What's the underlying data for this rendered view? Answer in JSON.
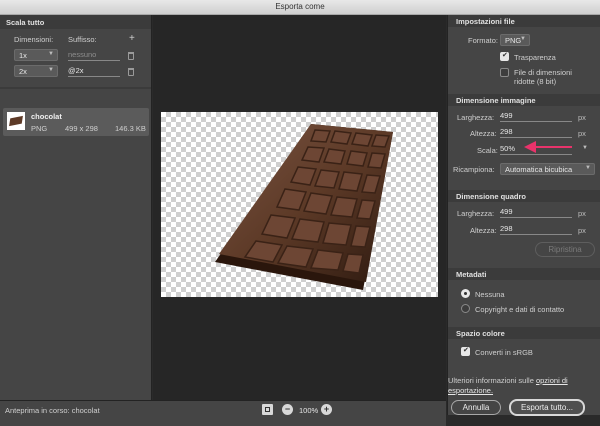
{
  "window": {
    "title": "Esporta come"
  },
  "left": {
    "section_title": "Scala tutto",
    "dimensions_header": "Dimensioni:",
    "suffix_header": "Suffisso:",
    "add_symbol": "+",
    "rows": [
      {
        "scale": "1x",
        "suffix": "",
        "suffix_placeholder": "nessuno"
      },
      {
        "scale": "2x",
        "suffix": "@2x",
        "suffix_placeholder": ""
      }
    ],
    "asset": {
      "name": "chocolat",
      "format": "PNG",
      "size": "499 x 298",
      "filesize": "146.3 KB"
    }
  },
  "preview": {
    "label": "Anteprima in corso:",
    "name": "chocolat",
    "zoom": "100%",
    "minus": "−",
    "plus": "+"
  },
  "right": {
    "file_settings": {
      "title": "Impostazioni file",
      "format_label": "Formato:",
      "format_value": "PNG",
      "transparency_label": "Trasparenza",
      "transparency_checked": true,
      "small_file_label_1": "File di dimensioni",
      "small_file_label_2": "ridotte (8 bit)",
      "small_file_checked": false
    },
    "image_size": {
      "title": "Dimensione immagine",
      "width_label": "Larghezza:",
      "width_value": "499",
      "height_label": "Altezza:",
      "height_value": "298",
      "scale_label": "Scala:",
      "scale_value": "50%",
      "resample_label": "Ricampiona:",
      "resample_value": "Automatica bicubica",
      "unit": "px"
    },
    "canvas_size": {
      "title": "Dimensione quadro",
      "width_label": "Larghezza:",
      "width_value": "499",
      "height_label": "Altezza:",
      "height_value": "298",
      "reset_label": "Ripristina",
      "unit": "px"
    },
    "metadata": {
      "title": "Metadati",
      "option_none": "Nessuna",
      "option_copyright": "Copyright e dati di contatto",
      "selected": "none"
    },
    "color_space": {
      "title": "Spazio colore",
      "convert_label": "Converti in sRGB",
      "convert_checked": true
    },
    "more_info_1": "Ulteriori informazioni sulle",
    "more_info_link_1": "opzioni di",
    "more_info_link_2": "esportazione."
  },
  "buttons": {
    "cancel": "Annulla",
    "export": "Esporta tutto..."
  },
  "colors": {
    "annotation_arrow": "#e8336b",
    "chocolate": "#5d3a27"
  }
}
